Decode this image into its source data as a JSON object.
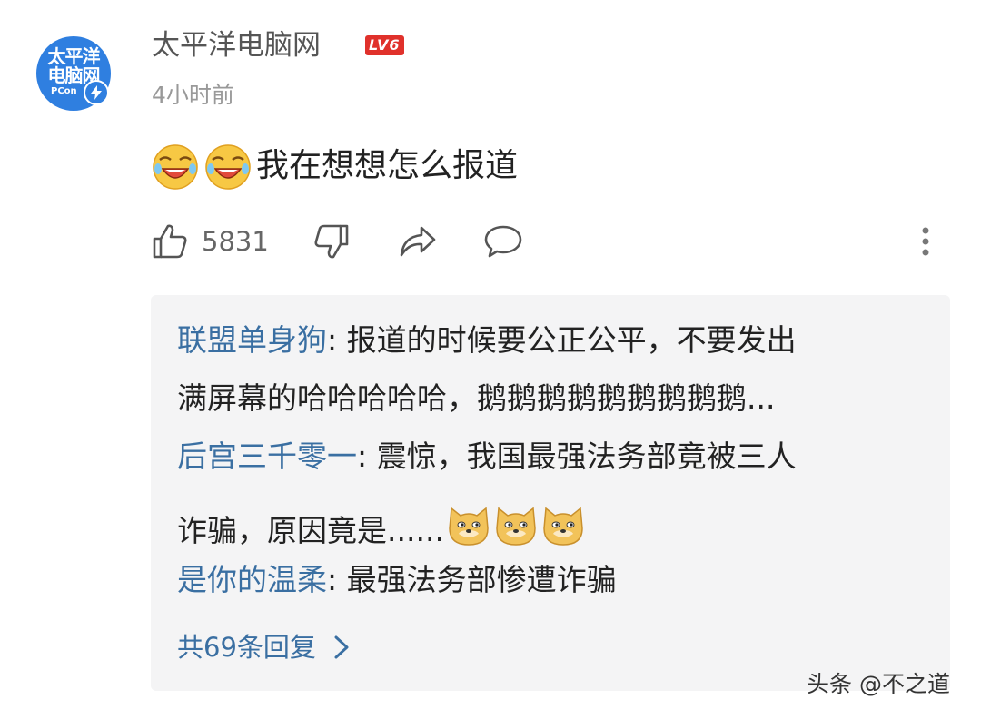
{
  "post": {
    "author": {
      "avatar_lines": [
        "太平洋",
        "电脑网"
      ],
      "avatar_sub": "PCon",
      "name": "太平洋电脑网",
      "level": "LV6"
    },
    "time": "4小时前",
    "content": "我在想想怎么报道",
    "like_count": "5831"
  },
  "icons": {
    "content_emoji": "laughing-crying-face-icon",
    "reply_emoji": "doge-icon",
    "like": "thumbs-up-icon",
    "dislike": "thumbs-down-icon",
    "share": "share-arrow-icon",
    "comment": "comment-bubble-icon",
    "more": "more-vertical-icon"
  },
  "replies": [
    {
      "name": "联盟单身狗",
      "lines": [
        "报道的时候要公正公平，不要发出",
        "满屏幕的哈哈哈哈哈，鹅鹅鹅鹅鹅鹅鹅鹅鹅..."
      ]
    },
    {
      "name": "后宫三千零一",
      "lines": [
        "震惊，我国最强法务部竟被三人",
        "诈骗，原因竟是......"
      ]
    },
    {
      "name": "是你的温柔",
      "lines": [
        "最强法务部惨遭诈骗"
      ]
    }
  ],
  "more_replies": "共69条回复",
  "watermark": "头条 @不之道",
  "colors": {
    "reply_name": "#3a6fa2",
    "level_badge": "#e0312b",
    "avatar": "#2f7fe0",
    "reply_bg": "#f4f4f5"
  }
}
